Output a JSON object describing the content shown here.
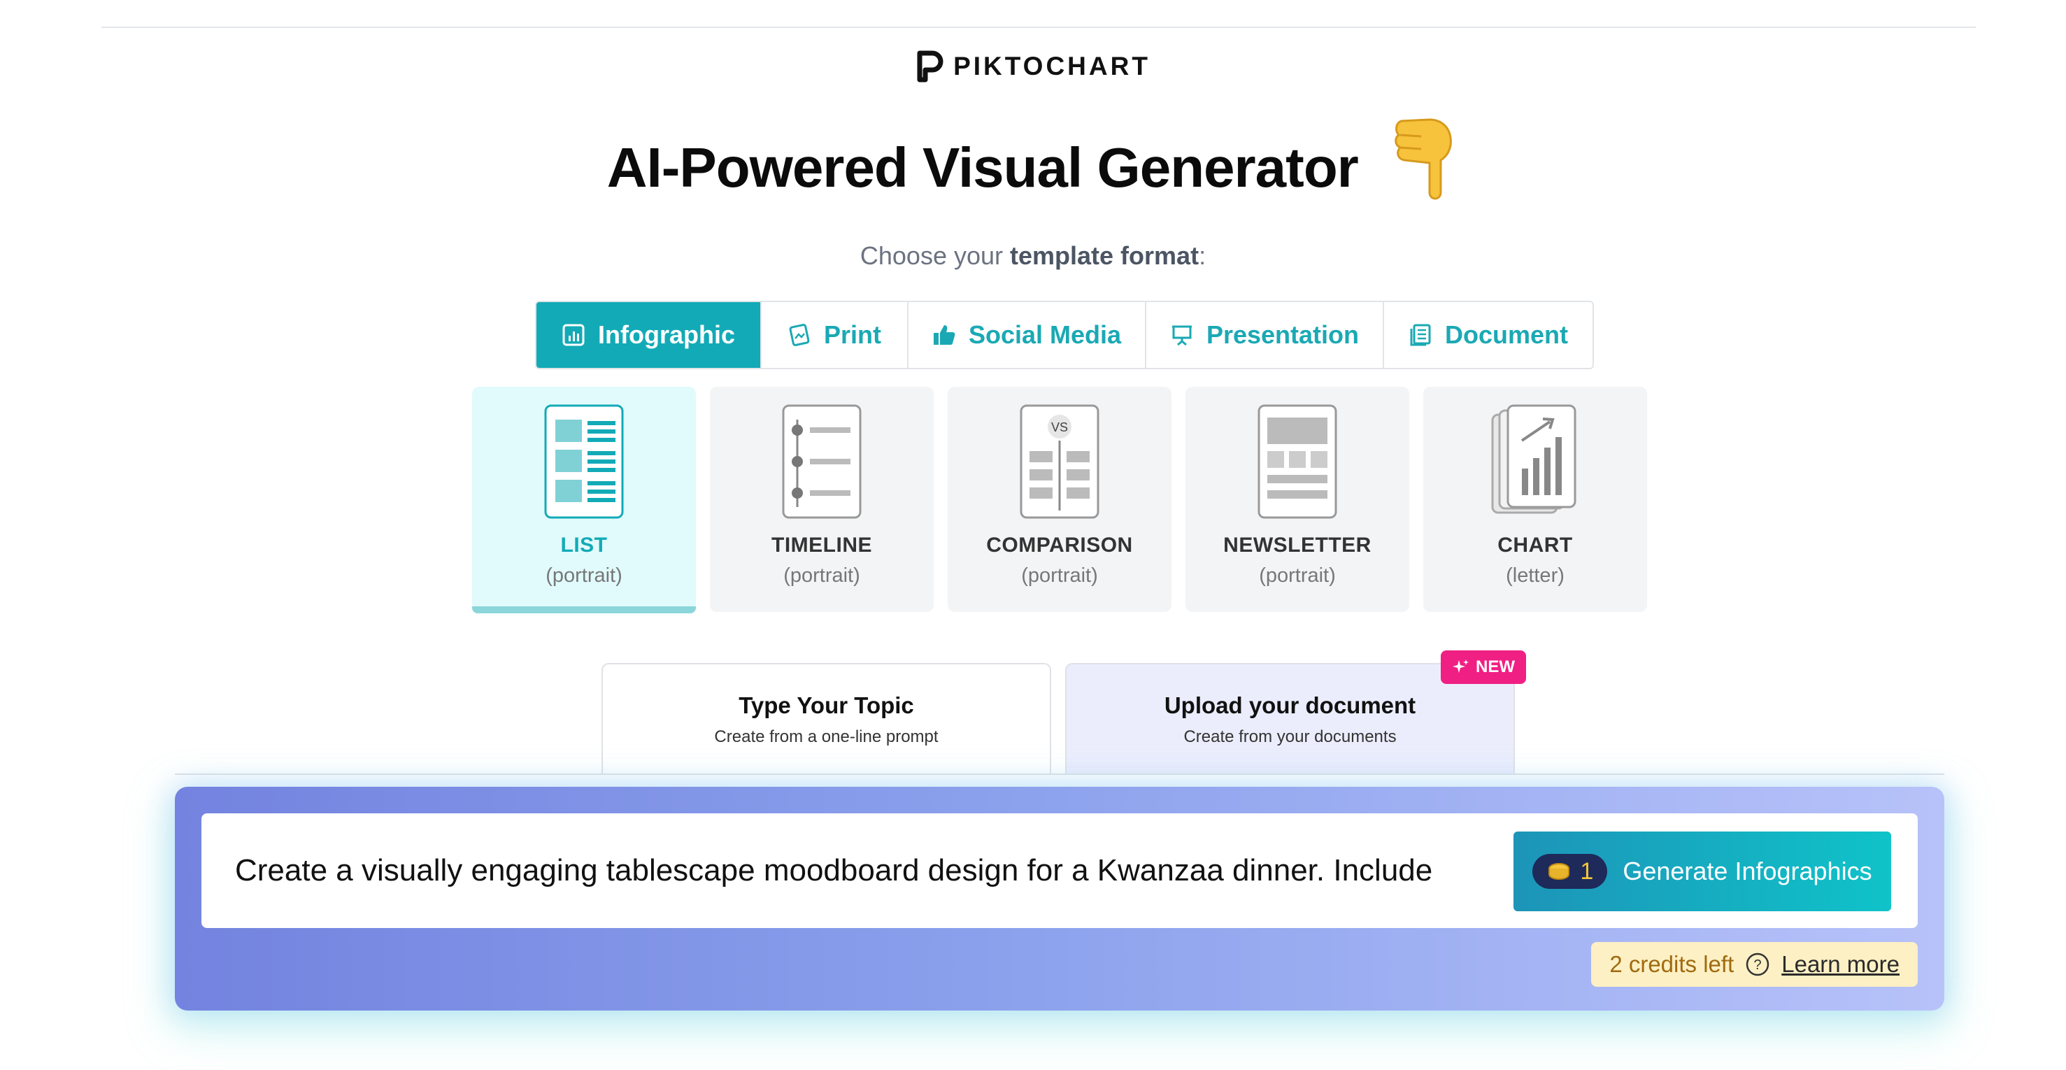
{
  "brand": {
    "name": "PIKTOCHART"
  },
  "hero": {
    "title": "AI-Powered Visual Generator"
  },
  "format_prompt": {
    "prefix": "Choose your ",
    "bold": "template format",
    "suffix": ":"
  },
  "format_tabs": [
    {
      "label": "Infographic",
      "icon": "chart-icon",
      "active": true
    },
    {
      "label": "Print",
      "icon": "print-icon",
      "active": false
    },
    {
      "label": "Social Media",
      "icon": "thumbs-up-icon",
      "active": false
    },
    {
      "label": "Presentation",
      "icon": "presentation-icon",
      "active": false
    },
    {
      "label": "Document",
      "icon": "document-icon",
      "active": false
    }
  ],
  "template_cards": [
    {
      "title": "LIST",
      "subtitle": "(portrait)",
      "active": true
    },
    {
      "title": "TIMELINE",
      "subtitle": "(portrait)",
      "active": false
    },
    {
      "title": "COMPARISON",
      "subtitle": "(portrait)",
      "active": false
    },
    {
      "title": "NEWSLETTER",
      "subtitle": "(portrait)",
      "active": false
    },
    {
      "title": "CHART",
      "subtitle": "(letter)",
      "active": false
    }
  ],
  "source_tabs": [
    {
      "title": "Type Your Topic",
      "subtitle": "Create from a one-line prompt",
      "active": true
    },
    {
      "title": "Upload your document",
      "subtitle": "Create from your documents",
      "active": false,
      "badge": "NEW"
    }
  ],
  "prompt": {
    "value": "Create a visually engaging tablescape moodboard design for a Kwanzaa dinner. Include",
    "credit_cost": "1",
    "button_label": "Generate Infographics"
  },
  "credits": {
    "remaining_text": "2 credits left",
    "learn_more": "Learn more"
  },
  "colors": {
    "accent": "#12aab7",
    "badge": "#f01f84",
    "credits_bg": "#fdf0c4"
  }
}
